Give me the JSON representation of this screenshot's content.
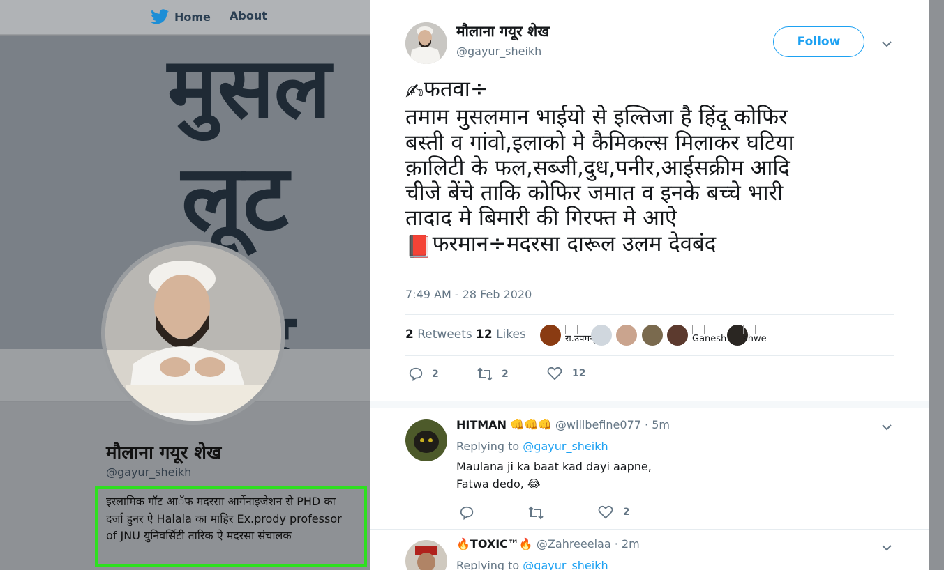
{
  "nav": {
    "home_label": "Home",
    "about_label": "About"
  },
  "banner": {
    "line1": "मुसल",
    "line2": "लूट",
    "line3": "न्द"
  },
  "profile": {
    "name": "मौलाना गयूर शेख",
    "handle": "@gayur_sheikh",
    "bio": "इस्लामिक गॉट आॅफ मदरसा आर्गेनाइजेशन से PHD का दर्जा हुनर ऐ Halala का माहिर Ex.prody professor of JNU युनिवर्सिटी तारिक ऐ मदरसा संचालक"
  },
  "tweet": {
    "author_name": "मौलाना गयूर शेख",
    "author_handle": "@gayur_sheikh",
    "follow_label": "Follow",
    "lead_emoji": "✍",
    "text_line1": "फतवा÷",
    "text_body": "तमाम मुसलमान भाईयो से इल्तिजा है हिंदू कोफिर\nबस्ती व गांवो,इलाको मे कैमिकल्स मिलाकर घटिया\nक़ालिटी के फल,सब्जी,दुध,पनीर,आईसक्रीम आदि\nचीजे बेंचे ताकि कोफिर जमात व इनके बच्चे भारी\nतादाद मे बिमारी की गिरफ्त मे आऐ",
    "book_emoji": "📕",
    "text_last": "फरमान÷मदरसा दारूल उलम देवबंद",
    "timestamp": "7:49 AM - 28 Feb 2020",
    "retweets_count": "2",
    "retweets_label": "Retweets",
    "likes_count": "12",
    "likes_label": "Likes",
    "liker_alt_1": "रा.उपमन्यु",
    "liker_alt_2": "Ganesh",
    "liker_alt_3": "shwe",
    "reply_count": "2",
    "retweet_count": "2",
    "like_count": "12"
  },
  "replies": [
    {
      "name": "HITMAN",
      "badges": "👊👊👊",
      "handle": "@willbefine077",
      "time": "· 5m",
      "replying_prefix": "Replying to",
      "replying_to": "@gayur_sheikh",
      "body": "Maulana ji ka baat kad dayi aapne,\nFatwa dedo, 😂",
      "reply_count": "",
      "retweet_count": "",
      "like_count": "2"
    },
    {
      "name_prefix": "🔥",
      "name": "TOXIC™",
      "name_suffix": "🔥",
      "handle": "@Zahreeelaa",
      "time": "· 2m",
      "replying_prefix": "Replying to",
      "replying_to": "@gayur_sheikh"
    }
  ],
  "colors": {
    "twitter_blue": "#1da1f2",
    "text_primary": "#14171a",
    "text_secondary": "#657786",
    "highlight_box": "#2de01f"
  }
}
